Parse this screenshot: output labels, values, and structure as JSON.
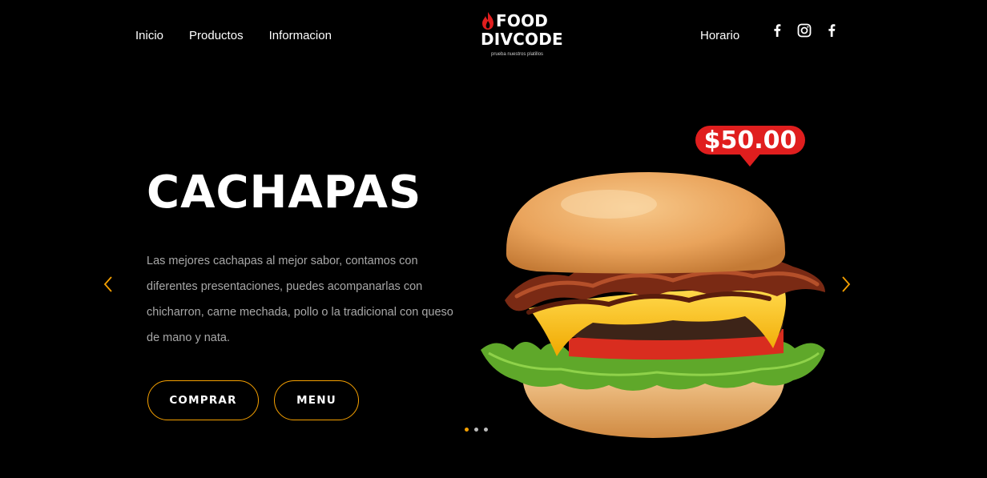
{
  "header": {
    "nav_left": [
      "Inicio",
      "Productos",
      "Informacion"
    ],
    "nav_right": "Horario",
    "logo": {
      "line1": "FOOD",
      "line2": "DIVCODE",
      "tagline": "prueba nuestros platillos"
    },
    "social_icons": [
      "facebook-icon",
      "instagram-icon",
      "facebook-icon"
    ]
  },
  "hero": {
    "title": "CACHAPAS",
    "description": "Las mejores cachapas al mejor sabor, contamos con diferentes presentaciones, puedes acompanarlas con chicharron, carne mechada, pollo o la tradicional con queso de mano y nata.",
    "buttons": {
      "buy": "COMPRAR",
      "menu": "MENU"
    },
    "price": "$50.00"
  },
  "slider": {
    "total": 3,
    "active": 1
  },
  "colors": {
    "accent": "#f5a000",
    "price_bg": "#e01e1e",
    "background": "#000000",
    "description": "#a8a8a8"
  }
}
